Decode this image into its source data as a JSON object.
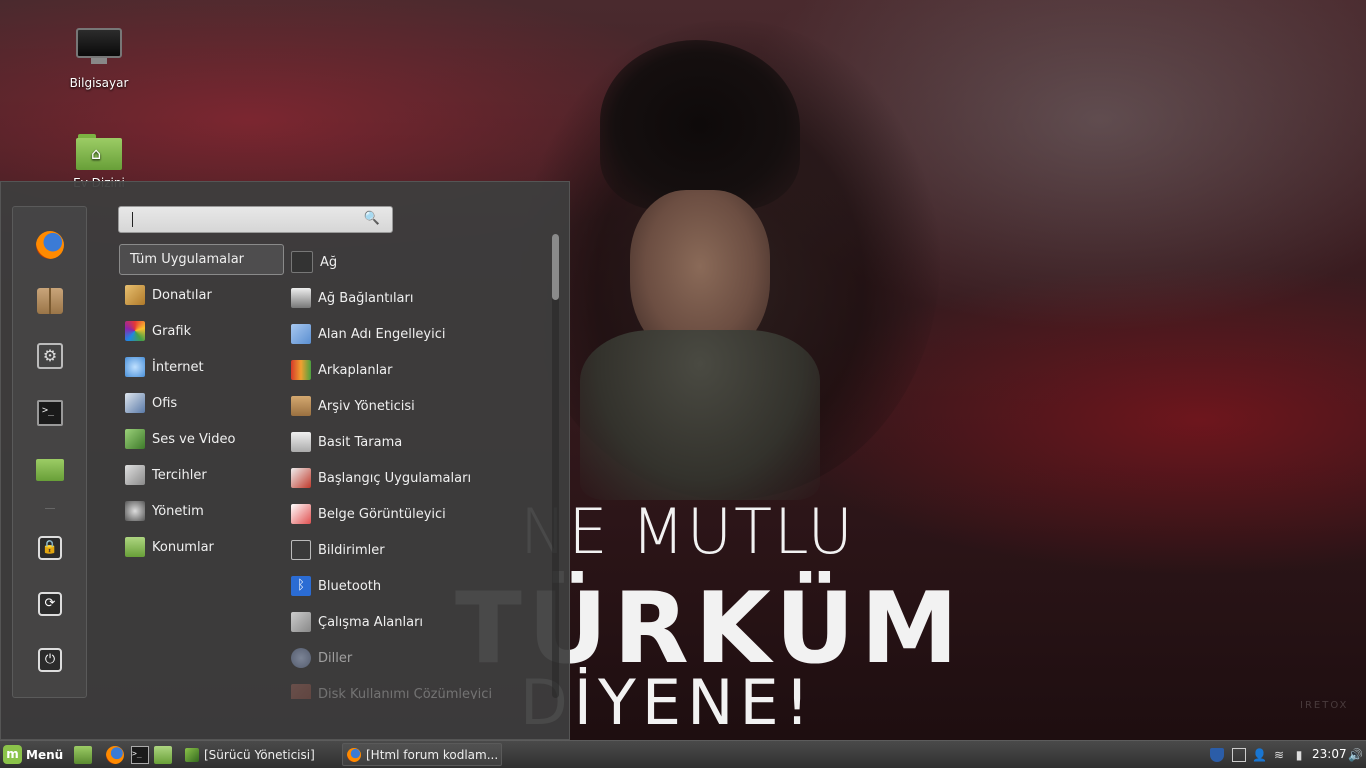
{
  "desktop": {
    "icons": [
      {
        "label": "Bilgisayar"
      },
      {
        "label": "Ev Dizini"
      }
    ]
  },
  "wallpaper": {
    "line1": "NE MUTLU",
    "line2": "TÜRKÜM",
    "line3": "DİYENE!",
    "watermark": "IRETOX"
  },
  "menu": {
    "search": {
      "value": "",
      "placeholder": ""
    },
    "favorites": [
      "firefox-icon",
      "package-icon",
      "settings-icon",
      "terminal-icon",
      "folder-icon",
      "lock-icon",
      "logout-icon",
      "power-icon"
    ],
    "categories": [
      {
        "label": "Tüm Uygulamalar",
        "icon": "none"
      },
      {
        "label": "Donatılar",
        "icon": "accessories-icon",
        "color": "#d9a441"
      },
      {
        "label": "Grafik",
        "icon": "graphics-icon",
        "color": "#e04a6a"
      },
      {
        "label": "İnternet",
        "icon": "internet-icon",
        "color": "#4a90d9"
      },
      {
        "label": "Ofis",
        "icon": "office-icon",
        "color": "#5a7aa8"
      },
      {
        "label": "Ses ve Video",
        "icon": "multimedia-icon",
        "color": "#6aa84f"
      },
      {
        "label": "Tercihler",
        "icon": "preferences-icon",
        "color": "#9a9a9a"
      },
      {
        "label": "Yönetim",
        "icon": "administration-icon",
        "color": "#777777"
      },
      {
        "label": "Konumlar",
        "icon": "places-icon",
        "color": "#8bc34a"
      }
    ],
    "apps": [
      {
        "label": "Ağ",
        "icon": "network-icon",
        "color": "#333333"
      },
      {
        "label": "Ağ Bağlantıları",
        "icon": "network-connections-icon",
        "color": "#444444"
      },
      {
        "label": "Alan Adı Engelleyici",
        "icon": "domain-blocker-icon",
        "color": "#5b8fd1"
      },
      {
        "label": "Arkaplanlar",
        "icon": "backgrounds-icon",
        "color": "#d67a2a"
      },
      {
        "label": "Arşiv Yöneticisi",
        "icon": "archive-manager-icon",
        "color": "#b48450"
      },
      {
        "label": "Basit Tarama",
        "icon": "scanner-icon",
        "color": "#cccccc"
      },
      {
        "label": "Başlangıç Uygulamaları",
        "icon": "startup-apps-icon",
        "color": "#c0392b"
      },
      {
        "label": "Belge Görüntüleyici",
        "icon": "document-viewer-icon",
        "color": "#e05050"
      },
      {
        "label": "Bildirimler",
        "icon": "notifications-icon",
        "color": "#555555"
      },
      {
        "label": "Bluetooth",
        "icon": "bluetooth-icon",
        "color": "#2b6cd4"
      },
      {
        "label": "Çalışma Alanları",
        "icon": "workspaces-icon",
        "color": "#999999"
      },
      {
        "label": "Diller",
        "icon": "languages-icon",
        "color": "#6a7a9a"
      },
      {
        "label": "Disk Kullanımı Çözümleyici",
        "icon": "disk-usage-icon",
        "color": "#b05a4a"
      }
    ]
  },
  "taskbar": {
    "menu_label": "Menü",
    "tasks": [
      {
        "label": "[Sürücü Yöneticisi]"
      },
      {
        "label": "[Html forum kodlam..."
      }
    ],
    "clock": "23:07"
  }
}
